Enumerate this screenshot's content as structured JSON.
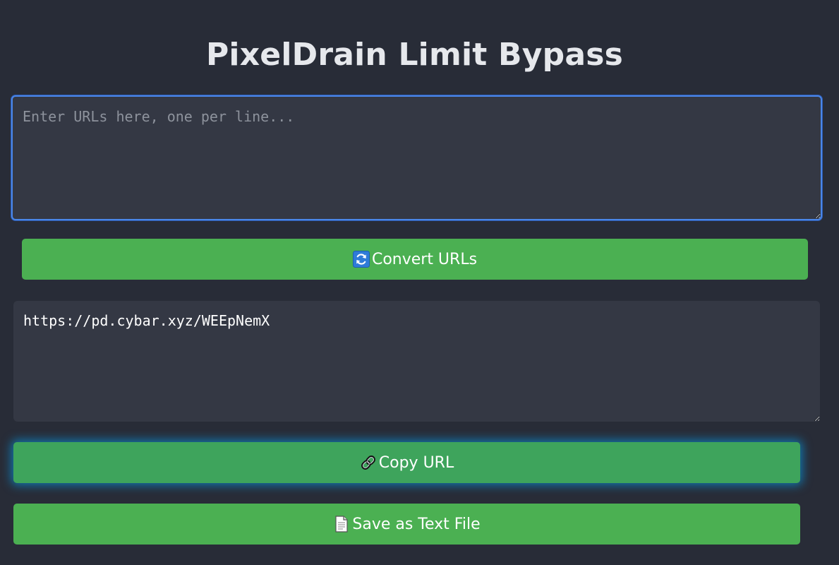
{
  "header": {
    "title": "PixelDrain Limit Bypass"
  },
  "input": {
    "placeholder": "Enter URLs here, one per line...",
    "value": ""
  },
  "convert_button": {
    "label": "Convert URLs",
    "icon": "refresh-icon"
  },
  "output": {
    "value": "https://pd.cybar.xyz/WEEpNemX"
  },
  "copy_button": {
    "label": "Copy URL",
    "icon": "link-icon"
  },
  "save_button": {
    "label": "Save as Text File",
    "icon": "document-icon"
  },
  "colors": {
    "background": "#282c37",
    "textarea_bg": "#343844",
    "button_green": "#4bb052",
    "focus_border": "#4a86e8",
    "glow": "#00aaff"
  }
}
